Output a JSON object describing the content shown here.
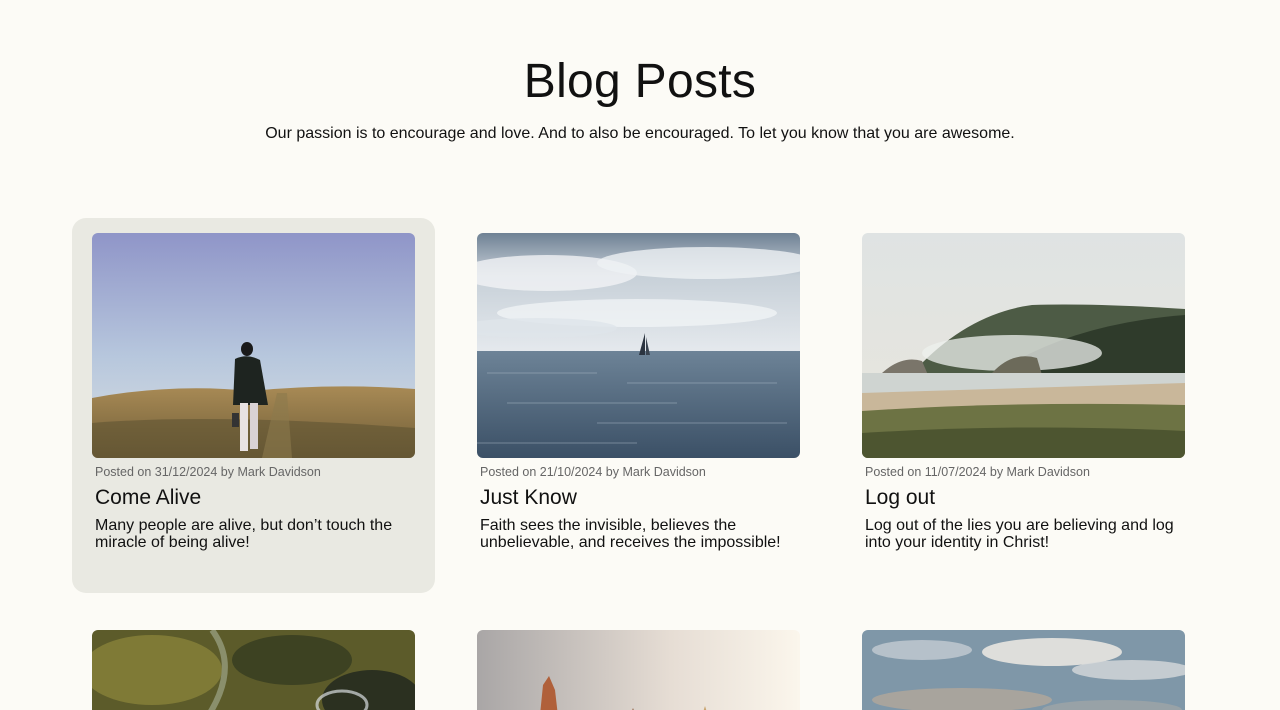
{
  "header": {
    "title": "Blog Posts",
    "subtitle": "Our passion is to encourage and love. And to also be encouraged. To let you know that you are awesome."
  },
  "posts": [
    {
      "meta": "Posted on 31/12/2024 by Mark Davidson",
      "title": "Come Alive",
      "excerpt": "Many people are alive, but don’t touch the miracle of being alive!",
      "image": "person-walking-in-field-photo"
    },
    {
      "meta": "Posted on 21/10/2024 by Mark Davidson",
      "title": "Just Know",
      "excerpt": "Faith sees the invisible, believes the unbelievable, and receives the impossible!",
      "image": "sailboat-on-ocean-photo"
    },
    {
      "meta": "Posted on 11/07/2024 by Mark Davidson",
      "title": "Log out",
      "excerpt": "Log out of the lies you are believing and log into your identity in Christ!",
      "image": "misty-coast-photo"
    },
    {
      "image": "aerial-green-terrain-photo"
    },
    {
      "image": "rock-formations-sunset-photo"
    },
    {
      "image": "cloudy-sky-photo"
    }
  ],
  "colors": {
    "background": "#fcfbf6",
    "card_hover": "#e9e9e2",
    "meta_text": "#666666"
  }
}
